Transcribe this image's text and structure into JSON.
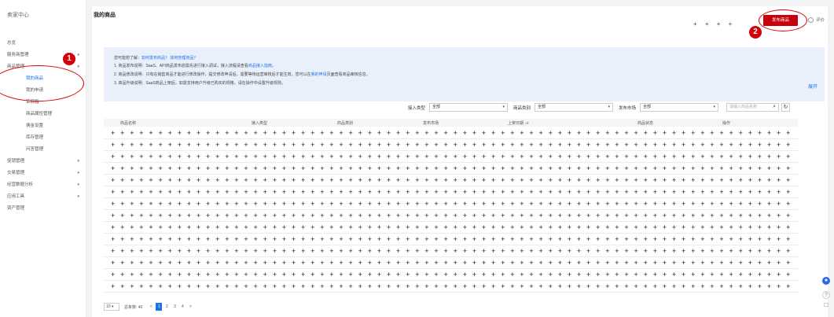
{
  "sidebar": {
    "title": "卖家中心",
    "items": [
      {
        "label": "总览",
        "arrow": ""
      },
      {
        "label": "服务商管理",
        "arrow": "▾"
      },
      {
        "label": "商品管理",
        "arrow": "▾"
      },
      {
        "label": "我的商品",
        "arrow": "",
        "sub": true,
        "active": true
      },
      {
        "label": "我的申请",
        "arrow": "",
        "sub": true
      },
      {
        "label": "草稿箱",
        "arrow": "",
        "sub": true
      },
      {
        "label": "商品属性管理",
        "arrow": "",
        "sub": true
      },
      {
        "label": "佣金设置",
        "arrow": "",
        "sub": true
      },
      {
        "label": "库存管理",
        "arrow": "",
        "sub": true
      },
      {
        "label": "问答管理",
        "arrow": "",
        "sub": true
      },
      {
        "label": "促销管理",
        "arrow": "▾"
      },
      {
        "label": "交易管理",
        "arrow": "▾"
      },
      {
        "label": "经营数据分析",
        "arrow": "▾"
      },
      {
        "label": "应用工具",
        "arrow": "▾"
      },
      {
        "label": "资产管理",
        "arrow": ""
      }
    ]
  },
  "header": {
    "title": "我的商品",
    "pluses": "+ + + +",
    "publish_label": "发布商品",
    "rate_label": "评价"
  },
  "annotations": {
    "badge1": "1",
    "badge2": "2"
  },
  "notice": {
    "line0_prefix": "您可能想了解：",
    "line0_link": "如何发布商品？ 如何管理商品？",
    "line1_prefix": "1. 商品发布说明：SaaS、API商品发布前需先进行接入调试，接入流程请查看",
    "line1_link": "商品接入指南",
    "line1_suffix": "。",
    "line2_prefix": "2. 商品修改说明：只有在销售商品才能进行修改操作，提交修改申请后，需要等待运营审核后才能生效。您可以在",
    "line2_link": "我的申请",
    "line2_suffix": "页面查看商品审核信息。",
    "line3": "3. 商品升级说明：SaaS商品上架后，如需支持用户升级已购买的规格，请在操作中设置升级规则。",
    "expand": "展开"
  },
  "filters": {
    "access_type_label": "接入类型",
    "access_type_value": "全部",
    "category_label": "商品类别",
    "category_value": "全部",
    "market_label": "发布市场",
    "market_value": "全部",
    "search_placeholder": "请输入商品名称"
  },
  "table": {
    "columns": [
      "商品名称",
      "接入类型",
      "商品类别",
      "发布市场",
      "上架日期 ↓≡",
      "商品状态",
      "操作"
    ]
  },
  "pagination": {
    "page_size": "10",
    "total": "总条数: 40",
    "prev": "<",
    "pages": [
      "1",
      "2",
      "3",
      "4"
    ],
    "current": "1",
    "next": ">"
  },
  "rail": {
    "chat_icon": "chat-icon",
    "help_icon": "help-icon",
    "note_icon": "note-icon"
  }
}
